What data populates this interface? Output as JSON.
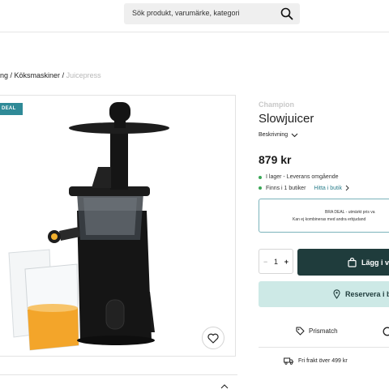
{
  "header": {
    "search_placeholder": "Sök produkt, varumärke, kategori"
  },
  "breadcrumb": {
    "items": [
      "ng",
      "Köksmaskiner"
    ],
    "separator": " / ",
    "current": "Juicepress"
  },
  "gallery": {
    "badge": "DEAL"
  },
  "product": {
    "brand": "Champion",
    "title": "Slowjuicer",
    "description_toggle": "Beskrivning",
    "price": "879 kr",
    "stock_online": "I lager - Leverans omgående",
    "stock_stores": "Finns i 1 butiker",
    "find_in_store_link": "Hitta i butik"
  },
  "deal_box": {
    "line1": "BRA DEAL - utmärkt pris va",
    "line2": "Kan ej kombineras med andra erbjudand"
  },
  "purchase": {
    "qty_minus": "−",
    "quantity": "1",
    "qty_plus": "+",
    "add_to_cart": "Lägg i va",
    "reserve": "Reservera i bu"
  },
  "perks": {
    "price_match": "Prismatch",
    "free_shipping": "Fri frakt över 499 kr"
  },
  "colors": {
    "primary": "#1f3c3c",
    "accent": "#2f8a97",
    "reserve_bg": "#cde9e6",
    "stock_green": "#3aa857"
  }
}
